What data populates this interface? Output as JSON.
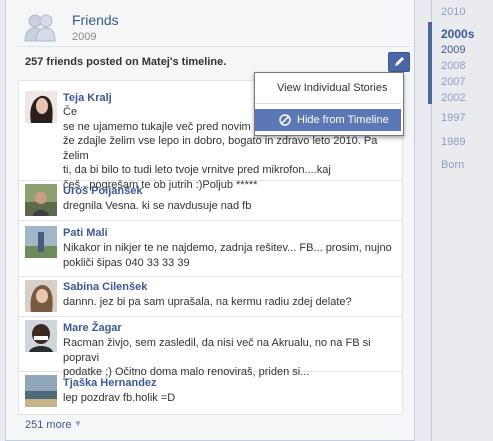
{
  "header": {
    "title": "Friends",
    "year": "2009"
  },
  "summary": {
    "text": "257 friends posted on Matej's timeline."
  },
  "menu": {
    "items": [
      "View Individual Stories",
      "Hide from Timeline"
    ]
  },
  "posts": [
    {
      "name": "Teja Kralj",
      "text": "Če\nse ne ujamemo tukajle več pred novim le\nže zdajle želim vse lepo in dobro, bogato in zdravo leto 2010. Pa želim\nti, da bi bilo to tudi leto tvoje vrnitve pred mikrofon....kaj\nčeš...pogrešam te ob jutrih :)Poljub *****"
    },
    {
      "name": "Uroš Poljanšek",
      "text": "dregnila Vesna. ki se navdusuje nad fb"
    },
    {
      "name": "Pati Mali",
      "text": "Nikakor in nikjer te ne najdemo, zadnja rešitev... FB... prosim, nujno\npokliči šipas 040 33 33 39"
    },
    {
      "name": "Sabina Cilenšek",
      "text": "dannn. jez bi pa sam uprašala, na kermu radiu zdej delate?"
    },
    {
      "name": "Mare Žagar",
      "text": "Racman živjo, sem zasledil, da nisi več na Akrualu, no na FB si popravi\npodatke ;) Očitno doma malo renoviraš, priden si..."
    },
    {
      "name": "Tjaška Hernandez",
      "text": "lep pozdrav fb.holik =D"
    }
  ],
  "more": {
    "label": "251 more"
  },
  "timeline": {
    "top": "2010",
    "decade": "2000s",
    "years": [
      "2009",
      "2008",
      "2007",
      "2002"
    ],
    "older": [
      "1997",
      "1989",
      "Born"
    ]
  }
}
